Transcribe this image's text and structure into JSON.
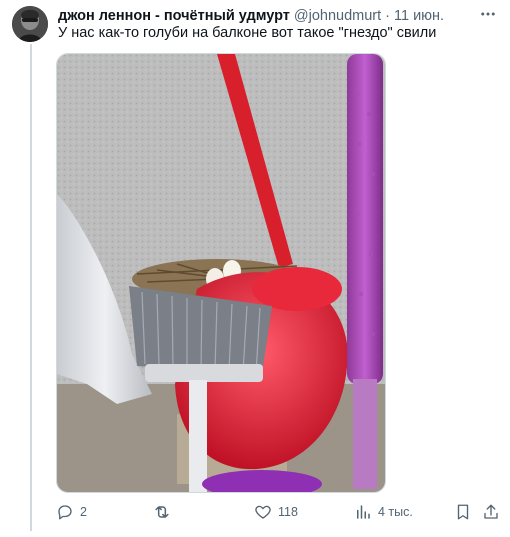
{
  "tweet": {
    "author_name": "джон леннон - почётный удмурт",
    "author_handle": "@johnudmurt",
    "separator": "·",
    "date": "11 июн.",
    "text": "У нас как-то голуби на балконе вот такое \"гнездо\" свили"
  },
  "icons": {
    "more": "more-dots-icon",
    "reply": "reply-icon",
    "retweet": "retweet-icon",
    "like": "heart-icon",
    "views": "views-chart-icon",
    "bookmark": "bookmark-icon",
    "share": "share-icon"
  },
  "actions": {
    "reply_count": "2",
    "retweet_count": "",
    "like_count": "118",
    "views_count": "4 тыс."
  },
  "colors": {
    "text_primary": "#0f1419",
    "text_secondary": "#536471",
    "thread_line": "#cfd9de"
  }
}
